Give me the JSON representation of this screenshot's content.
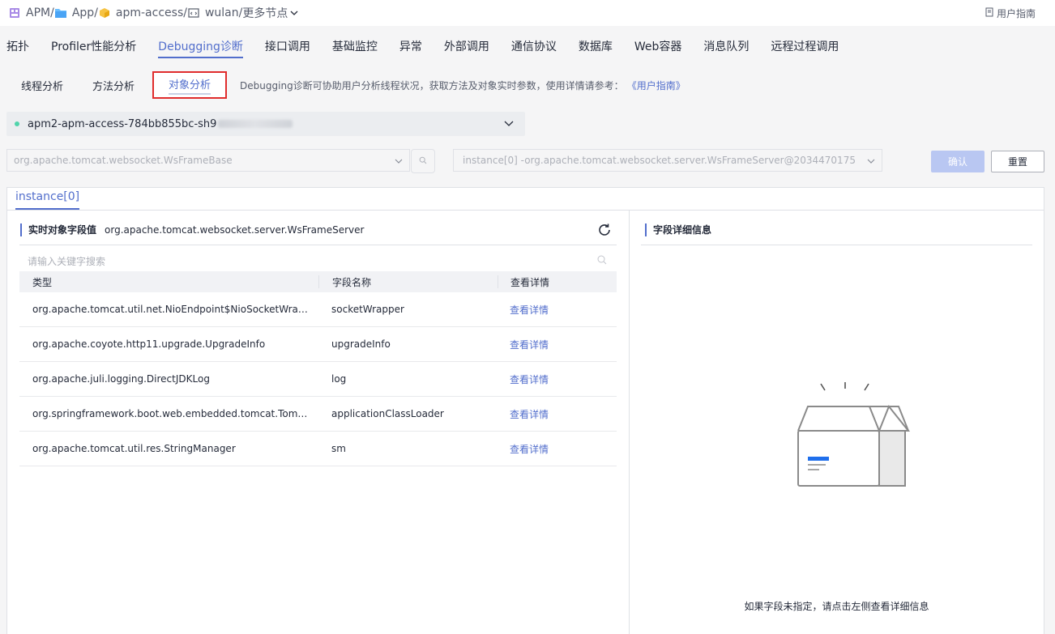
{
  "breadcrumb": [
    {
      "label": "APM",
      "icon": "apm-icon"
    },
    {
      "label": "App",
      "icon": "folder-icon"
    },
    {
      "label": "apm-access",
      "icon": "cube-icon"
    },
    {
      "label": "wulan",
      "icon": "code-window-icon"
    },
    {
      "label": "更多节点",
      "icon": "chevron-down-icon"
    }
  ],
  "header": {
    "guide_label": "用户指南"
  },
  "main_tabs": [
    {
      "label": "拓扑"
    },
    {
      "label": "Profiler性能分析"
    },
    {
      "label": "Debugging诊断",
      "active": true
    },
    {
      "label": "接口调用"
    },
    {
      "label": "基础监控"
    },
    {
      "label": "异常"
    },
    {
      "label": "外部调用"
    },
    {
      "label": "通信协议"
    },
    {
      "label": "数据库"
    },
    {
      "label": "Web容器"
    },
    {
      "label": "消息队列"
    },
    {
      "label": "远程过程调用"
    }
  ],
  "sub_tabs": [
    {
      "label": "线程分析"
    },
    {
      "label": "方法分析"
    },
    {
      "label": "对象分析",
      "active": true
    }
  ],
  "description": {
    "text": "Debugging诊断可协助用户分析线程状况，获取方法及对象实时参数，使用详情请参考：",
    "link": "《用户指南》"
  },
  "pod_select": {
    "value": "apm2-apm-access-784bb855bc-sh9",
    "status_color": "#50d4ab"
  },
  "class_select": {
    "value": "org.apache.tomcat.websocket.WsFrameBase"
  },
  "instance_select": {
    "value": "instance[0] -org.apache.tomcat.websocket.server.WsFrameServer@2034470175"
  },
  "buttons": {
    "confirm": "确认",
    "reset": "重置"
  },
  "instance_tab": {
    "label": "instance[0]"
  },
  "left_panel": {
    "title": "实时对象字段值",
    "class_name": "org.apache.tomcat.websocket.server.WsFrameServer",
    "search_placeholder": "请输入关键字搜索",
    "columns": [
      "类型",
      "字段名称",
      "查看详情"
    ],
    "rows": [
      {
        "type": "org.apache.tomcat.util.net.NioEndpoint$NioSocketWrapper",
        "field": "socketWrapper",
        "action": "查看详情"
      },
      {
        "type": "org.apache.coyote.http11.upgrade.UpgradeInfo",
        "field": "upgradeInfo",
        "action": "查看详情"
      },
      {
        "type": "org.apache.juli.logging.DirectJDKLog",
        "field": "log",
        "action": "查看详情"
      },
      {
        "type": "org.springframework.boot.web.embedded.tomcat.TomcatEm...",
        "field": "applicationClassLoader",
        "action": "查看详情"
      },
      {
        "type": "org.apache.tomcat.util.res.StringManager",
        "field": "sm",
        "action": "查看详情"
      }
    ]
  },
  "right_panel": {
    "title": "字段详细信息",
    "empty_text": "如果字段未指定，请点击左侧查看详细信息"
  },
  "colors": {
    "accent": "#526ecc",
    "highlight_border": "#e02c2c",
    "confirm_disabled": "#b9c7f2"
  }
}
